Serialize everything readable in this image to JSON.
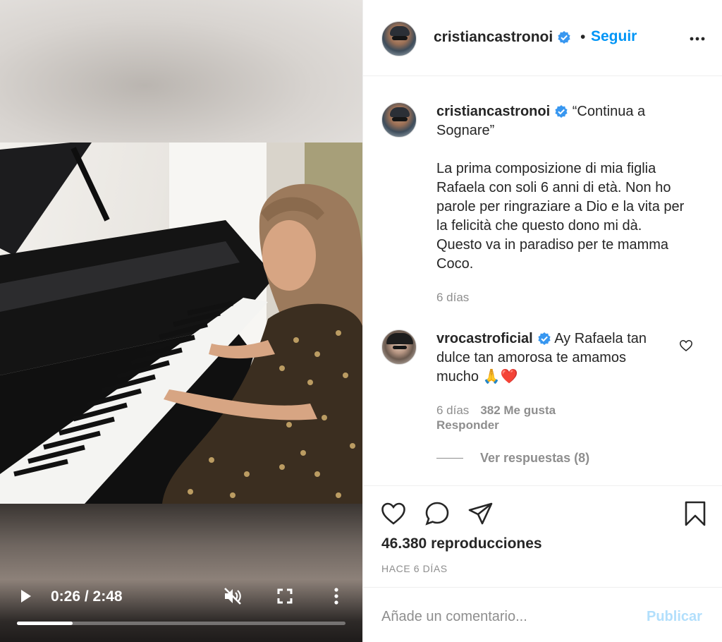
{
  "video": {
    "current_time": "0:26",
    "duration": "2:48",
    "time_separator": " / ",
    "progress_fraction": 0.17,
    "icons": {
      "play": "play-icon",
      "mute": "mute-icon",
      "fullscreen": "fullscreen-icon",
      "more": "more-vertical-icon"
    }
  },
  "header": {
    "username": "cristiancastronoi",
    "separator": "•",
    "follow_label": "Seguir",
    "icons": {
      "verified": "verified-icon",
      "more": "more-horizontal-icon"
    }
  },
  "caption": {
    "username": "cristiancastronoi",
    "title": "“Continua a Sognare”",
    "body": "La prima composizione di mia figlia Rafaela con soli 6 anni di età. Non ho parole per ringraziare a Dio e la vita per la felicità che questo dono mi dà. Questo va in paradiso per te mamma Coco.",
    "time": "6 días"
  },
  "comment": {
    "username": "vrocastroficial",
    "text": "Ay Rafaela tan dulce tan amorosa te amamos mucho 🙏❤️",
    "time": "6 días",
    "likes": "382 Me gusta",
    "reply_label": "Responder",
    "view_replies_label": "Ver respuestas (8)"
  },
  "actions": {
    "views": "46.380 reproducciones",
    "date": "HACE 6 DÍAS",
    "icons": [
      "heart-icon",
      "comment-icon",
      "share-icon",
      "bookmark-icon"
    ]
  },
  "comment_box": {
    "placeholder": "Añade un comentario...",
    "publish_label": "Publicar"
  },
  "colors": {
    "accent": "#0095f6",
    "muted_text": "#8e8e8e",
    "publish_disabled": "#b2dffc",
    "border": "#efefef"
  }
}
